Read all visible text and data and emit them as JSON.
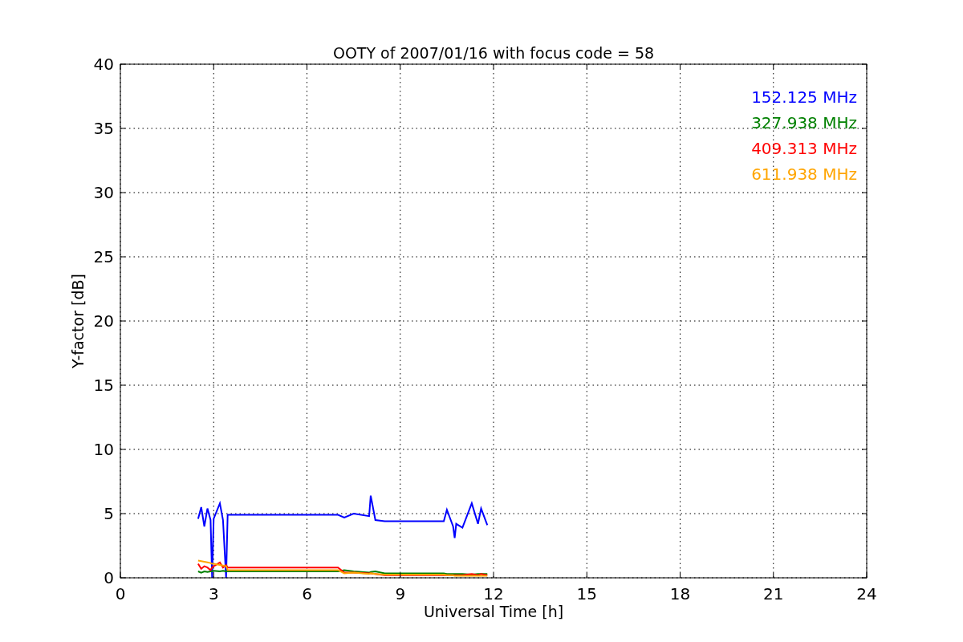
{
  "chart_data": {
    "type": "line",
    "title": "OOTY of 2007/01/16 with focus code = 58",
    "xlabel": "Universal Time [h]",
    "ylabel": "Y-factor [dB]",
    "xlim": [
      0,
      24
    ],
    "ylim": [
      0,
      40
    ],
    "xticks": [
      0,
      3,
      6,
      9,
      12,
      15,
      18,
      21,
      24
    ],
    "yticks": [
      0,
      5,
      10,
      15,
      20,
      25,
      30,
      35,
      40
    ],
    "grid": true,
    "x": [
      2.5,
      2.6,
      2.7,
      2.8,
      2.9,
      2.95,
      3.0,
      3.2,
      3.3,
      3.4,
      3.45,
      7.0,
      7.2,
      7.5,
      8.0,
      8.05,
      8.2,
      8.5,
      10.4,
      10.5,
      10.7,
      10.75,
      10.8,
      11.0,
      11.3,
      11.5,
      11.6,
      11.8
    ],
    "series": [
      {
        "name": "152.125 MHz",
        "color": "#0000ff",
        "values": [
          4.6,
          5.5,
          4.0,
          5.4,
          4.5,
          0.0,
          4.6,
          5.8,
          4.5,
          0.0,
          4.9,
          4.9,
          4.7,
          5.0,
          4.8,
          6.4,
          4.5,
          4.4,
          4.4,
          5.3,
          4.0,
          3.1,
          4.2,
          3.9,
          5.8,
          4.2,
          5.4,
          4.1
        ]
      },
      {
        "name": "327.938 MHz",
        "color": "#008000",
        "values": [
          0.5,
          0.4,
          0.5,
          0.45,
          0.5,
          0.5,
          0.55,
          0.5,
          0.55,
          0.5,
          0.5,
          0.5,
          0.6,
          0.5,
          0.4,
          0.45,
          0.5,
          0.35,
          0.35,
          0.3,
          0.3,
          0.3,
          0.3,
          0.3,
          0.25,
          0.3,
          0.3,
          0.3
        ]
      },
      {
        "name": "409.313 MHz",
        "color": "#ff0000",
        "values": [
          1.1,
          0.7,
          0.9,
          0.8,
          0.6,
          0.8,
          0.9,
          1.2,
          0.8,
          1.0,
          0.8,
          0.8,
          0.4,
          0.4,
          0.35,
          0.35,
          0.3,
          0.2,
          0.2,
          0.2,
          0.2,
          0.2,
          0.2,
          0.2,
          0.3,
          0.2,
          0.3,
          0.2
        ]
      },
      {
        "name": "611.938 MHz",
        "color": "#ffa500",
        "values": [
          1.35,
          1.3,
          1.25,
          1.2,
          1.15,
          1.1,
          1.1,
          1.0,
          0.95,
          0.9,
          0.6,
          0.6,
          0.35,
          0.4,
          0.3,
          0.35,
          0.3,
          0.25,
          0.25,
          0.2,
          0.2,
          0.15,
          0.15,
          0.15,
          0.15,
          0.15,
          0.15,
          0.15
        ]
      }
    ]
  }
}
